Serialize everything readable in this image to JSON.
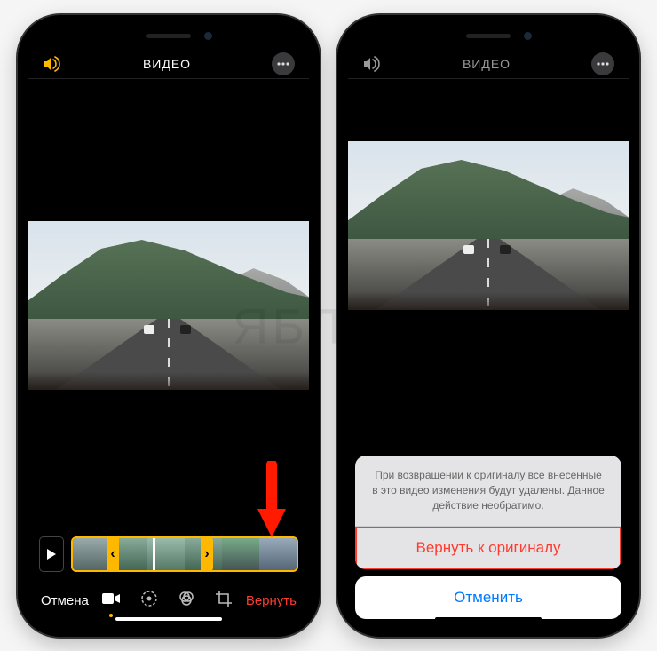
{
  "watermark": "ЯБЛЫК",
  "header": {
    "title": "ВИДЕО"
  },
  "toolbar": {
    "cancel": "Отмена",
    "revert": "Вернуть"
  },
  "sheet": {
    "message": "При возвращении к оригиналу все внесенные в это видео изменения будут удалены. Данное действие необратимо.",
    "revert": "Вернуть к оригиналу",
    "cancel": "Отменить"
  },
  "icons": {
    "volume": "volume-icon",
    "more": "more-icon",
    "play": "play-icon",
    "video": "video-mode-icon",
    "adjust": "adjust-icon",
    "filters": "filters-icon",
    "crop": "crop-icon"
  }
}
